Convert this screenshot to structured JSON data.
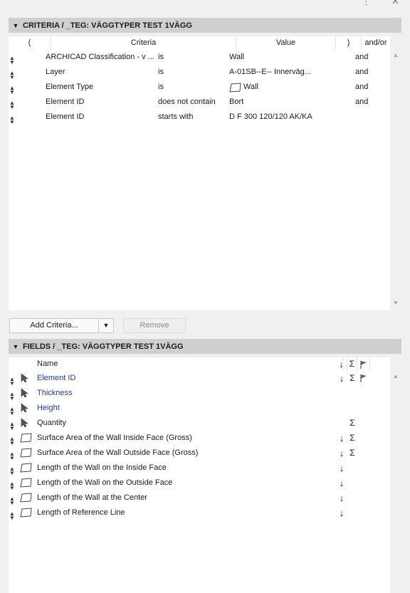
{
  "window_controls": {
    "more": "⋮",
    "close": "✕"
  },
  "criteria": {
    "header": "CRITERIA / _TEG: VÄGGTYPER TEST 1VÄGG",
    "columns": {
      "open_paren": "(",
      "criteria": "Criteria",
      "value": "Value",
      "close_paren": ")",
      "andor": "and/or"
    },
    "rows": [
      {
        "property": "ARCHICAD Classification - v ...",
        "operator": "is",
        "value": "Wall",
        "andor": "and",
        "icon": ""
      },
      {
        "property": "Layer",
        "operator": "is",
        "value": "A-01SB--E-- Innerväg...",
        "andor": "and",
        "icon": ""
      },
      {
        "property": "Element Type",
        "operator": "is",
        "value": "Wall",
        "andor": "and",
        "icon": "wall-icon"
      },
      {
        "property": "Element ID",
        "operator": "does not contain",
        "value": "Bort",
        "andor": "and",
        "icon": ""
      },
      {
        "property": "Element ID",
        "operator": "starts with",
        "value": "D F 300 120/120 AK/KA",
        "andor": "",
        "icon": ""
      }
    ],
    "add_button": "Add Criteria...",
    "remove_button": "Remove"
  },
  "fields": {
    "header": "FIELDS / _TEG: VÄGGTYPER TEST 1VÄGG",
    "columns": {
      "name": "Name",
      "sort": "↓",
      "sum": "Σ"
    },
    "rows": [
      {
        "name": "Element ID",
        "icon": "cursor-icon",
        "blue": true,
        "sort": "↓",
        "sum": "Σ",
        "flag": true
      },
      {
        "name": "Thickness",
        "icon": "cursor-icon",
        "blue": true,
        "sort": "",
        "sum": "",
        "flag": false
      },
      {
        "name": "Height",
        "icon": "cursor-icon",
        "blue": true,
        "sort": "",
        "sum": "",
        "flag": false
      },
      {
        "name": "Quantity",
        "icon": "cursor-icon",
        "blue": false,
        "sort": "",
        "sum": "Σ",
        "flag": false
      },
      {
        "name": "Surface Area of the Wall Inside Face (Gross)",
        "icon": "wall-icon",
        "blue": false,
        "sort": "↓",
        "sum": "Σ",
        "flag": false
      },
      {
        "name": "Surface Area of the Wall Outside Face (Gross)",
        "icon": "wall-icon",
        "blue": false,
        "sort": "↓",
        "sum": "Σ",
        "flag": false
      },
      {
        "name": "Length of the Wall on the Inside Face",
        "icon": "wall-icon",
        "blue": false,
        "sort": "↓",
        "sum": "",
        "flag": false
      },
      {
        "name": "Length of the Wall on the Outside Face",
        "icon": "wall-icon",
        "blue": false,
        "sort": "↓",
        "sum": "",
        "flag": false
      },
      {
        "name": "Length of the Wall at the Center",
        "icon": "wall-icon",
        "blue": false,
        "sort": "↓",
        "sum": "",
        "flag": false
      },
      {
        "name": "Length of Reference Line",
        "icon": "wall-icon",
        "blue": false,
        "sort": "↓",
        "sum": "",
        "flag": false
      }
    ]
  }
}
